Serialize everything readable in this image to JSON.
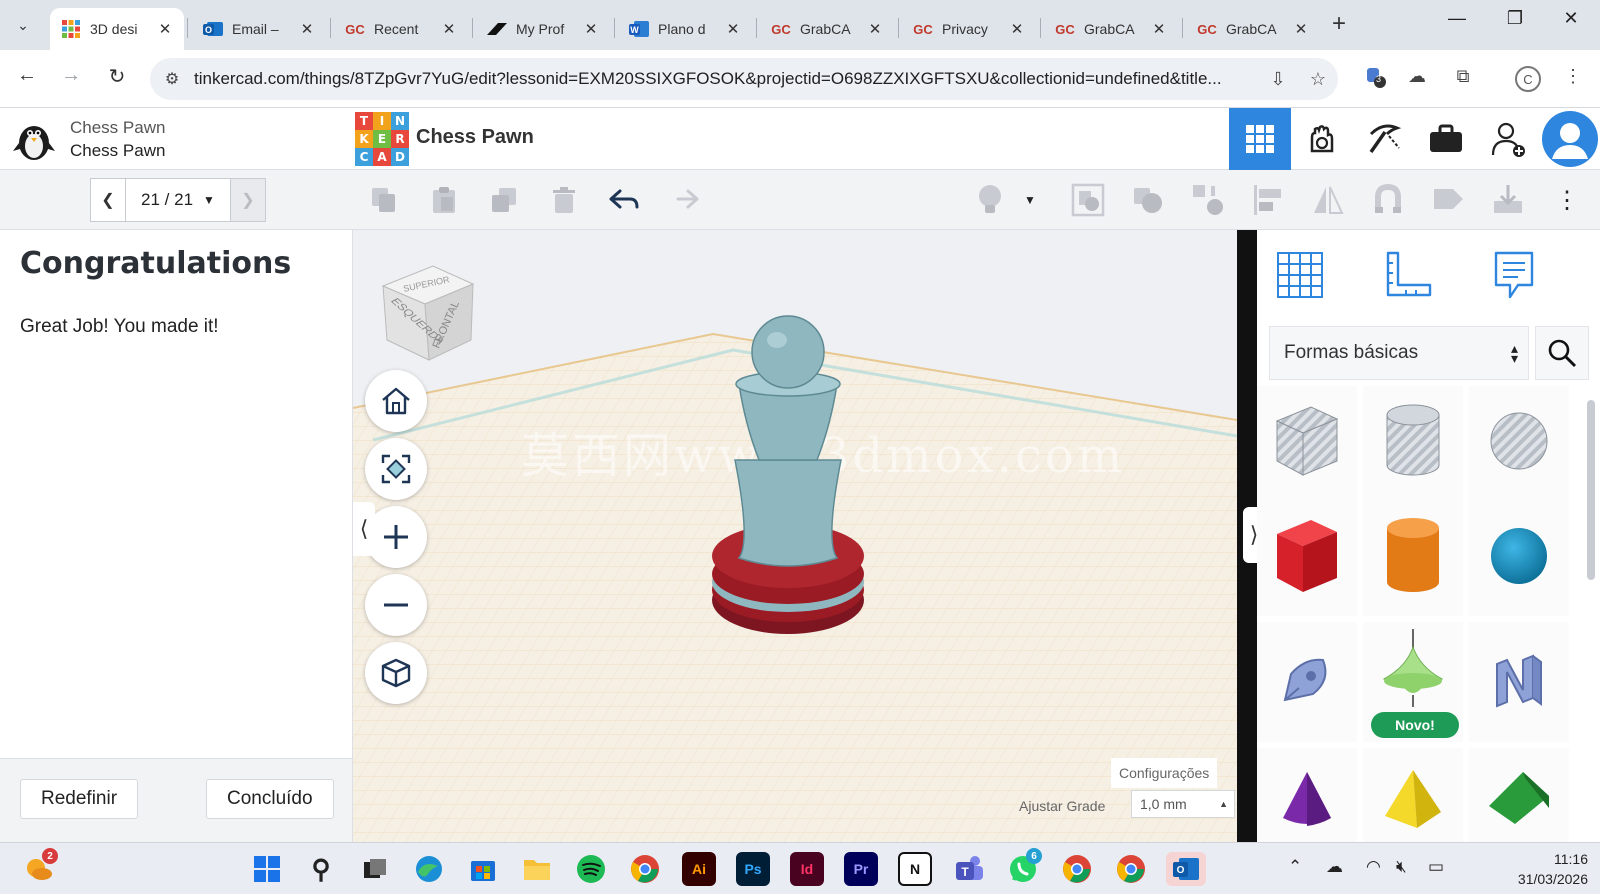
{
  "browser": {
    "tabs": [
      {
        "label": "3D desi",
        "favicon": "tinkercad-grid-icon",
        "active": true
      },
      {
        "label": "Email –",
        "favicon": "outlook-icon",
        "active": false
      },
      {
        "label": "Recent ",
        "favicon": "GC",
        "active": false
      },
      {
        "label": "My Prof",
        "favicon": "gamma-icon",
        "active": false
      },
      {
        "label": "Plano d",
        "favicon": "word-icon",
        "active": false
      },
      {
        "label": "GrabCA",
        "favicon": "GC",
        "active": false
      },
      {
        "label": "Privacy",
        "favicon": "GC",
        "active": false
      },
      {
        "label": "GrabCA",
        "favicon": "GC",
        "active": false
      },
      {
        "label": "GrabCA",
        "favicon": "GC",
        "active": false
      }
    ],
    "url": "tinkercad.com/things/8TZpGvr7YuG/edit?lessonid=EXM20SSIXGFOSOK&projectid=O698ZZXIXGFTSXU&collectionid=undefined&title...",
    "extension_badge": "3",
    "profile_letter": "C"
  },
  "header": {
    "project_name_1": "Chess Pawn",
    "project_name_2": "Chess Pawn",
    "logo_letters": [
      "T",
      "I",
      "N",
      "K",
      "E",
      "R",
      "C",
      "A",
      "D"
    ],
    "design_title": "Chess Pawn"
  },
  "toolbar": {
    "step_counter": "21 / 21"
  },
  "lesson": {
    "heading": "Congratulations",
    "body": "Great Job! You made it!",
    "reset_label": "Redefinir",
    "done_label": "Concluído"
  },
  "viewport": {
    "watermark": "莫西网www.3dmox.com",
    "viewcube_left": "ESQUERDA",
    "viewcube_front": "FRONTAL",
    "viewcube_top": "SUPERIOR",
    "settings_label": "Configurações",
    "snap_grid_label": "Ajustar Grade",
    "snap_grid_value": "1,0 mm"
  },
  "shapes": {
    "category": "Formas básicas",
    "new_badge": "Novo!",
    "items": [
      "box-hole",
      "cylinder-hole",
      "sphere-hole",
      "box",
      "cylinder",
      "sphere",
      "scribble",
      "spinning-top",
      "text-n",
      "cone",
      "pyramid",
      "roof"
    ]
  },
  "taskbar": {
    "weather_badge": "2",
    "whatsapp_badge": "6",
    "time": "11:16",
    "date": "31/03/2026"
  },
  "colors": {
    "accent": "#2e86de",
    "pawn_body": "#8fb7c0",
    "pawn_base": "#9b1b24",
    "workplane": "#f4efe6",
    "new_badge": "#1e9b57"
  }
}
